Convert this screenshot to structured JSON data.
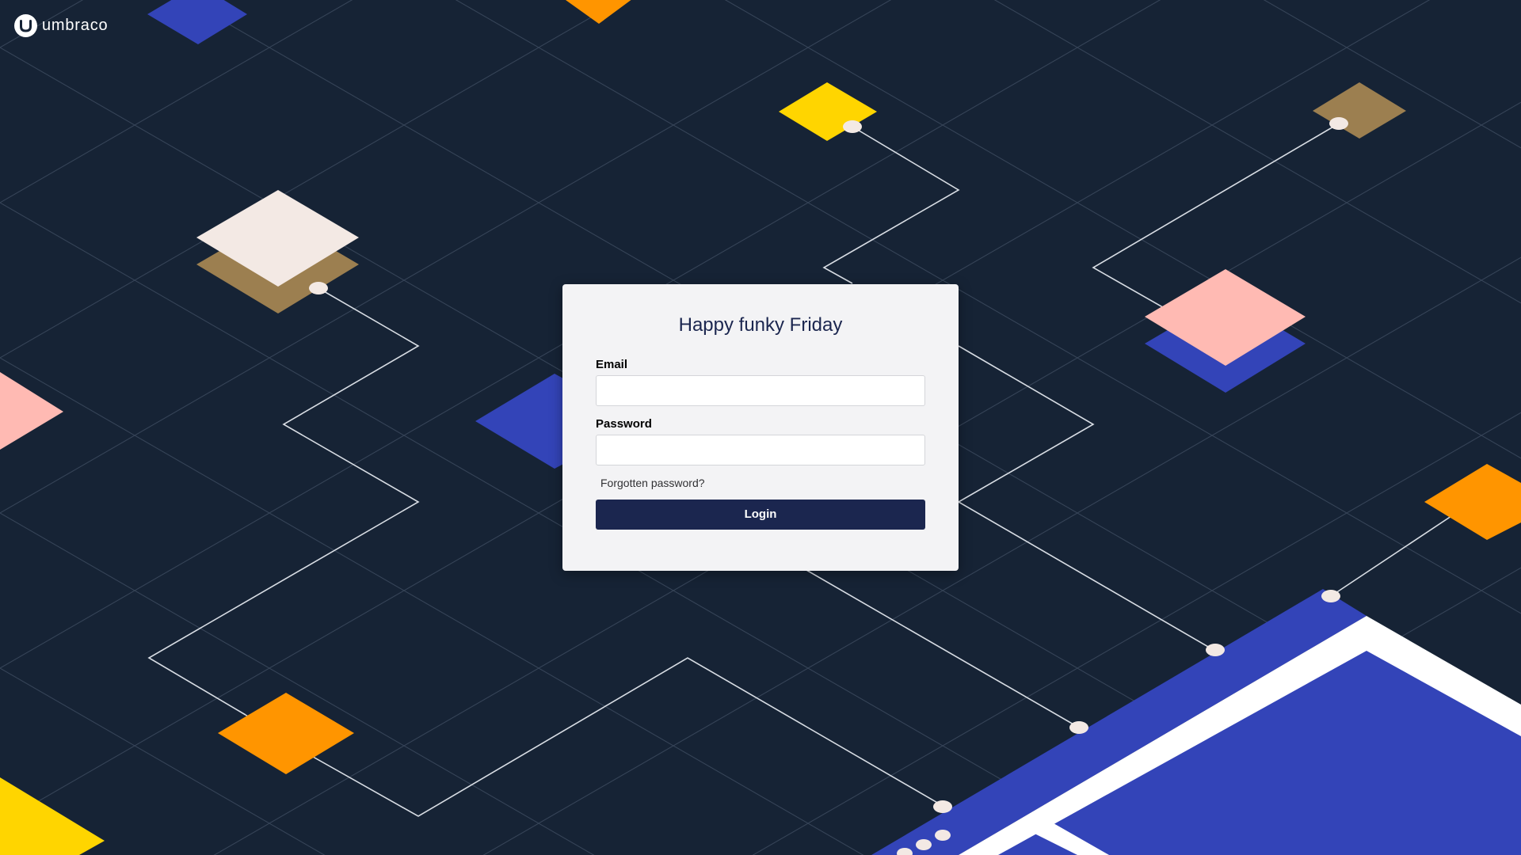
{
  "brand": {
    "name": "umbraco",
    "logo_icon": "umbraco-u-icon"
  },
  "login": {
    "greeting": "Happy funky Friday",
    "email_label": "Email",
    "email_value": "",
    "password_label": "Password",
    "password_value": "",
    "forgot_password": "Forgotten password?",
    "submit_label": "Login"
  },
  "theme": {
    "background": "#162335",
    "accent_navy": "#1b264f",
    "blue": "#3344b8",
    "orange": "#ff9500",
    "yellow": "#ffd500",
    "pink": "#ffbab3",
    "brown": "#9c7f50",
    "cream": "#f3e9e4"
  }
}
